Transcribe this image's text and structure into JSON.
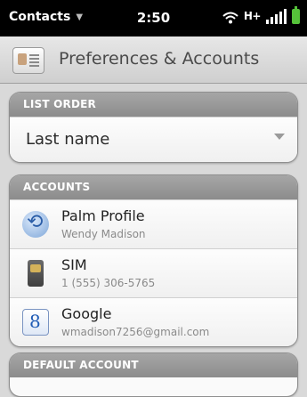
{
  "status_bar": {
    "app_menu": "Contacts",
    "time": "2:50",
    "network": "H+",
    "icons": {
      "menu": "chevron-down-icon",
      "wifi": "wifi-icon",
      "signal": "signal-bars-icon",
      "battery": "battery-icon"
    },
    "battery_color": "#56c23a"
  },
  "header": {
    "icon": "contacts-card-icon",
    "title": "Preferences & Accounts"
  },
  "list_order": {
    "label": "LIST ORDER",
    "selected": "Last name"
  },
  "accounts": {
    "label": "ACCOUNTS",
    "items": [
      {
        "icon": "palm-profile-icon",
        "title": "Palm Profile",
        "subtitle": "Wendy Madison"
      },
      {
        "icon": "sim-card-icon",
        "title": "SIM",
        "subtitle": "1 (555) 306-5765"
      },
      {
        "icon": "google-icon",
        "title": "Google",
        "subtitle": "wmadison7256@gmail.com"
      }
    ]
  },
  "default_account": {
    "label": "DEFAULT ACCOUNT"
  }
}
